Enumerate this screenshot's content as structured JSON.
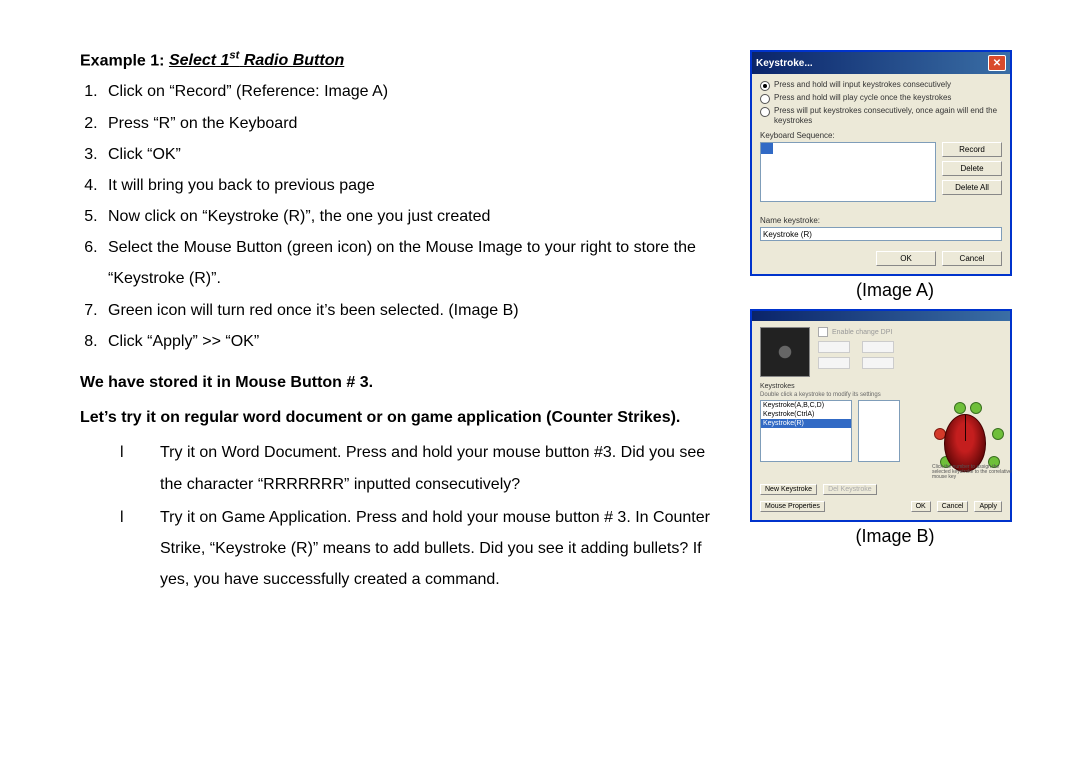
{
  "heading_prefix": "Example 1:   ",
  "heading_title_before_sup": "Select 1",
  "heading_sup": "st",
  "heading_title_after_sup": " Radio Button",
  "steps": [
    "Click on “Record” (Reference:    Image A)",
    "Press “R” on the Keyboard",
    "Click “OK”",
    "It will bring you back to previous page",
    "Now click on “Keystroke (R)”, the one you just created",
    "Select the Mouse Button (green icon) on the Mouse Image to your right to store the “Keystroke (R)”.",
    "Green icon will turn red once it’s been selected. (Image B)",
    "Click “Apply” >> “OK”"
  ],
  "bold_line1": "We have stored it in Mouse Button # 3.",
  "bold_line2": "Let’s try it on regular word document or on game application (Counter Strikes).",
  "sub_items": [
    "Try it on Word Document.    Press and hold your mouse button #3. Did you see the character “RRRRRRR” inputted consecutively?",
    "Try it on Game Application.    Press and hold your mouse button # 3. In Counter Strike, “Keystroke (R)” means to add bullets.    Did you see it adding bullets?    If yes, you have successfully created a command."
  ],
  "bullet_char": "l",
  "imageA": {
    "title": "Keystroke...",
    "radio1": "Press and hold will input keystrokes consecutively",
    "radio2": "Press and hold will play cycle once the keystrokes",
    "radio3": "Press will put keystrokes consecutively, once again will end the keystrokes",
    "seq_label": "Keyboard Sequence:",
    "btn_record": "Record",
    "btn_delete": "Delete",
    "btn_deleteall": "Delete All",
    "name_label": "Name keystroke:",
    "name_value": "Keystroke (R)",
    "btn_ok": "OK",
    "btn_cancel": "Cancel",
    "caption": "(Image A)"
  },
  "imageB": {
    "enable_dpi": "Enable change DPI",
    "section_label": "Keystrokes",
    "hint": "Double click a keystroke to modify its settings",
    "list": [
      "Keystroke(A,B,C,D)",
      "Keystroke(CtrlA)",
      "Keystroke(R)"
    ],
    "btn_new": "New Keystroke",
    "btn_del": "Del Keystroke",
    "btn_props": "Mouse Properties",
    "btn_ok": "OK",
    "btn_cancel": "Cancel",
    "btn_apply": "Apply",
    "mouse_hint": "Click the number to assign the selected keystroke to the correlative mouse key",
    "caption": "(Image B)"
  }
}
